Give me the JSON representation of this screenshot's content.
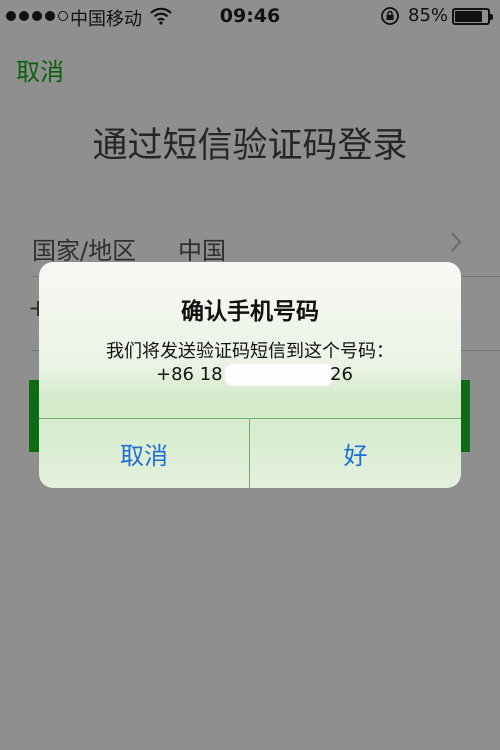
{
  "status_bar": {
    "carrier": "中国移动",
    "time": "09:46",
    "battery_percent": "85%",
    "battery_level": 0.85,
    "signal_bars_filled": 4,
    "icons": [
      "signal-dots-icon",
      "wifi-icon",
      "rotation-lock-icon",
      "battery-icon"
    ]
  },
  "page": {
    "nav_cancel": "取消",
    "title": "通过短信验证码登录",
    "country_label": "国家/地区",
    "country_value": "中国",
    "phone_prefix": "+"
  },
  "alert": {
    "title": "确认手机号码",
    "message": "我们将发送验证码短信到这个号码：",
    "phone_start": "+86 18",
    "phone_end": "26",
    "cancel_label": "取消",
    "ok_label": "好"
  },
  "colors": {
    "accent_green": "#0d5e0d",
    "alert_button_blue": "#1f6fd6",
    "overlay_gray": "#8f8f8f"
  }
}
